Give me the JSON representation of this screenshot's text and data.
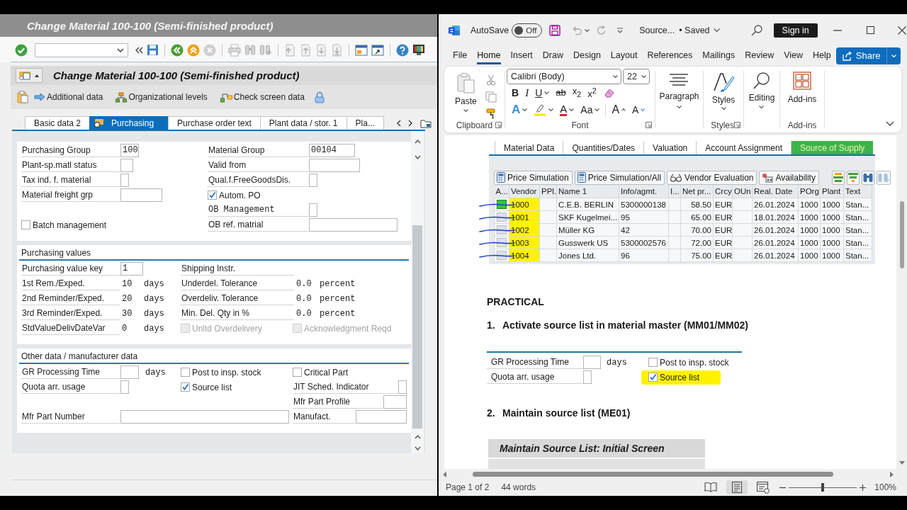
{
  "sap": {
    "window_title": "Change Material 100-100 (Semi-finished product)",
    "screen_title": "Change Material 100-100 (Semi-finished product)",
    "app_toolbar": [
      {
        "kind": "additional",
        "label": "Additional data"
      },
      {
        "kind": "org",
        "label": "Organizational levels"
      },
      {
        "kind": "check",
        "label": "Check screen data"
      }
    ],
    "tabs": [
      {
        "label": "Basic data 2",
        "selected": false
      },
      {
        "label": "Purchasing",
        "selected": true
      },
      {
        "label": "Purchase order text",
        "selected": false
      },
      {
        "label": "Plant data / stor. 1",
        "selected": false
      },
      {
        "label": "Pla...",
        "selected": false
      }
    ],
    "sections": [
      {
        "rows": [
          {
            "col_1": {
              "kind": "field",
              "label": "Purchasing Group",
              "value": "100"
            },
            "col_2": {
              "kind": "field",
              "label": "Material Group",
              "value": "00104"
            }
          },
          {
            "col_1": {
              "kind": "field",
              "label": "Plant-sp.matl status"
            },
            "col_2": {
              "kind": "field",
              "label": "Valid from"
            }
          },
          {
            "col_1": {
              "kind": "field",
              "label": "Tax ind. f. material"
            },
            "col_2": {
              "kind": "field",
              "label": "Qual.f.FreeGoodsDis."
            }
          },
          {
            "col_1": {
              "kind": "field",
              "label": "Material freight grp"
            },
            "col_2": {
              "kind": "checkbox",
              "label": "Autom. PO",
              "checked": true,
              "disabled": false
            }
          },
          {
            "col_2": {
              "kind": "field",
              "label": "OB Management"
            }
          },
          {
            "col_1": {
              "kind": "checkbox",
              "label": "Batch management",
              "checked": false,
              "disabled": false
            },
            "col_2": {
              "kind": "field",
              "label": "OB ref. matrial"
            }
          }
        ]
      },
      {
        "title": "Purchasing values",
        "rows": [
          {
            "col_1": {
              "kind": "field",
              "label": "Purchasing value key",
              "value": "1"
            },
            "col_2": {
              "kind": "label",
              "label": "Shipping Instr."
            }
          },
          {
            "col_1": {
              "kind": "reading",
              "label": "1st Rem./Exped.",
              "value": "10",
              "unit": "days"
            },
            "col_2": {
              "kind": "reading",
              "label": "Underdel. Tolerance",
              "value": "0.0",
              "unit": "percent"
            }
          },
          {
            "col_1": {
              "kind": "reading",
              "label": "2nd Reminder/Exped.",
              "value": "20",
              "unit": "days"
            },
            "col_2": {
              "kind": "reading",
              "label": "Overdeliv. Tolerance",
              "value": "0.0",
              "unit": "percent"
            }
          },
          {
            "col_1": {
              "kind": "reading",
              "label": "3rd Reminder/Exped.",
              "value": "30",
              "unit": "days"
            },
            "col_2": {
              "kind": "reading",
              "label": "Min. Del. Qty in %",
              "value": "0.0",
              "unit": "percent"
            }
          },
          {
            "col_1": {
              "kind": "reading",
              "label": "StdValueDelivDateVar",
              "value": "0",
              "unit": "days"
            },
            "col_2": {
              "kind": "checkbox",
              "label": "Unltd Overdelivery",
              "checked": false,
              "disabled": true
            },
            "col_3": {
              "kind": "checkbox",
              "label": "Acknowledgment Reqd",
              "checked": false,
              "disabled": true
            }
          }
        ]
      },
      {
        "title": "Other data / manufacturer data",
        "rows": [
          {
            "col_1": {
              "kind": "field",
              "label": "GR Processing Time",
              "unit": "days"
            },
            "col_2": {
              "kind": "checkbox",
              "label": "Post to insp. stock",
              "checked": false,
              "disabled": false
            },
            "col_3": {
              "kind": "checkbox",
              "label": "Critical Part",
              "checked": false,
              "disabled": false
            }
          },
          {
            "col_1": {
              "kind": "field",
              "label": "Quota arr. usage"
            },
            "col_2": {
              "kind": "checkbox",
              "label": "Source list",
              "checked": true,
              "disabled": false
            },
            "col_3": {
              "kind": "field",
              "label": "JIT Sched. Indicator"
            }
          },
          {
            "col_3": {
              "kind": "field",
              "label": "Mfr Part Profile"
            }
          },
          {
            "col_1": {
              "kind": "field",
              "label": "Mfr Part Number"
            },
            "col_3": {
              "kind": "field",
              "label": "Manufact."
            }
          }
        ]
      }
    ]
  },
  "word": {
    "autosave_label": "AutoSave",
    "autosave": {
      "on": false,
      "label": "Off"
    },
    "document_name": "Source...",
    "save_status": "• Saved",
    "sign_in": "Sign in",
    "menu": [
      {
        "label": "File",
        "selected": false
      },
      {
        "label": "Home",
        "selected": true
      },
      {
        "label": "Insert",
        "selected": false
      },
      {
        "label": "Draw",
        "selected": false
      },
      {
        "label": "Design",
        "selected": false
      },
      {
        "label": "Layout",
        "selected": false
      },
      {
        "label": "References",
        "selected": false
      },
      {
        "label": "Mailings",
        "selected": false
      },
      {
        "label": "Review",
        "selected": false
      },
      {
        "label": "View",
        "selected": false
      },
      {
        "label": "Help",
        "selected": false
      }
    ],
    "share": "Share",
    "ribbon": [
      {
        "kind": "clipboard",
        "button": "Paste",
        "label": "Clipboard"
      },
      {
        "kind": "font",
        "font_name": "Calibri (Body)",
        "font_size": "22",
        "label": "Font",
        "tools_row_1": [
          {
            "kind": "bold",
            "label": "B"
          },
          {
            "kind": "italic",
            "label": "I"
          },
          {
            "kind": "underline",
            "label": "U"
          },
          {
            "kind": "strikethrough",
            "label": "ab"
          },
          {
            "kind": "subscript",
            "label": "x$_{2}$"
          },
          {
            "kind": "superscript",
            "label": "x$^{2}$"
          },
          {
            "kind": "clear"
          }
        ],
        "tools_row_2": [
          {
            "kind": "effects",
            "label": "A"
          },
          {
            "kind": "highlight"
          },
          {
            "kind": "color",
            "label": "A"
          },
          {
            "kind": "case",
            "label": "Aa"
          },
          {
            "kind": "grow",
            "label": "A"
          },
          {
            "kind": "shrink",
            "label": "A"
          }
        ]
      },
      {
        "kind": "paragraph",
        "button": "Paragraph"
      },
      {
        "kind": "styles",
        "button": "Styles",
        "label": "Styles"
      },
      {
        "kind": "editing",
        "button": "Editing"
      },
      {
        "kind": "addins",
        "button": "Add-ins",
        "label": "Add-ins"
      }
    ],
    "document": [
      {
        "kind": "sap_screen",
        "tabs": [
          {
            "label": "Material Data",
            "selected": false,
            "highlighted": false
          },
          {
            "label": "Quantities/Dates",
            "selected": false,
            "highlighted": false
          },
          {
            "label": "Valuation",
            "selected": false,
            "highlighted": false
          },
          {
            "label": "Account Assignment",
            "selected": false,
            "highlighted": false
          },
          {
            "label": "Source of Supply",
            "selected": true,
            "highlighted": true
          }
        ],
        "toolbar": [
          {
            "kind": "simulation",
            "label": "Price Simulation"
          },
          {
            "kind": "simulation",
            "label": "Price Simulation/All"
          },
          {
            "kind": "evaluation",
            "label": "Vendor Evaluation"
          },
          {
            "kind": "availability",
            "label": "Availability"
          }
        ],
        "columns": [
          "A...",
          "Vendor",
          "PPl.",
          "Name 1",
          "Info/agmt.",
          "I...",
          "Net pr...",
          "Crcy",
          "OUn",
          "Real. Date",
          "POrg",
          "Plant",
          "Text"
        ],
        "rows": [
          {
            "selected": true,
            "highlighted": true,
            "pen_mark": true,
            "cells": [
              "",
              "1000",
              "",
              "C.E.B. BERLIN",
              "5300000138",
              "",
              "58.50",
              "EUR",
              "",
              "26.01.2024",
              "1000",
              "1000",
              "Stan..."
            ]
          },
          {
            "selected": false,
            "highlighted": true,
            "pen_mark": true,
            "cells": [
              "",
              "1001",
              "",
              "SKF Kugelmei...",
              "95",
              "",
              "65.00",
              "EUR",
              "",
              "18.01.2024",
              "1000",
              "1000",
              "Stan..."
            ]
          },
          {
            "selected": false,
            "highlighted": true,
            "pen_mark": true,
            "cells": [
              "",
              "1002",
              "",
              "Müller KG",
              "42",
              "",
              "70.00",
              "EUR",
              "",
              "26.01.2024",
              "1000",
              "1000",
              "Stan..."
            ]
          },
          {
            "selected": false,
            "highlighted": true,
            "pen_mark": true,
            "cells": [
              "",
              "1003",
              "",
              "Gusswerk US",
              "5300002576",
              "",
              "72.00",
              "EUR",
              "",
              "26.01.2024",
              "1000",
              "1000",
              "Stan..."
            ]
          },
          {
            "selected": false,
            "highlighted": true,
            "pen_mark": true,
            "cells": [
              "",
              "1004",
              "",
              "Jones Ltd.",
              "96",
              "",
              "75.00",
              "EUR",
              "",
              "26.01.2024",
              "1000",
              "1000",
              "Stan..."
            ]
          }
        ]
      },
      {
        "kind": "heading",
        "text": "PRACTICAL"
      },
      {
        "kind": "step",
        "number": "1.",
        "text": "Activate source list in material master (MM01/MM02)"
      },
      {
        "kind": "sap_fields",
        "rows": [
          {
            "label": "GR Processing Time",
            "unit": "days",
            "checkbox": {
              "label": "Post to insp. stock",
              "checked": false,
              "highlighted": false
            }
          },
          {
            "label": "Quota arr. usage",
            "checkbox": {
              "label": "Source list",
              "checked": true,
              "highlighted": true
            }
          }
        ]
      },
      {
        "kind": "step",
        "number": "2.",
        "text": "Maintain source list (ME01)"
      },
      {
        "kind": "sap_title",
        "text": "Maintain Source List: Initial Screen"
      }
    ],
    "status_bar": {
      "page": "Page 1 of 2",
      "words": "44 words",
      "views": [
        {
          "kind": "read",
          "selected": false
        },
        {
          "kind": "print",
          "selected": true
        },
        {
          "kind": "web",
          "selected": false
        }
      ],
      "zoom": {
        "level": 0.5,
        "label": "100%"
      }
    }
  }
}
